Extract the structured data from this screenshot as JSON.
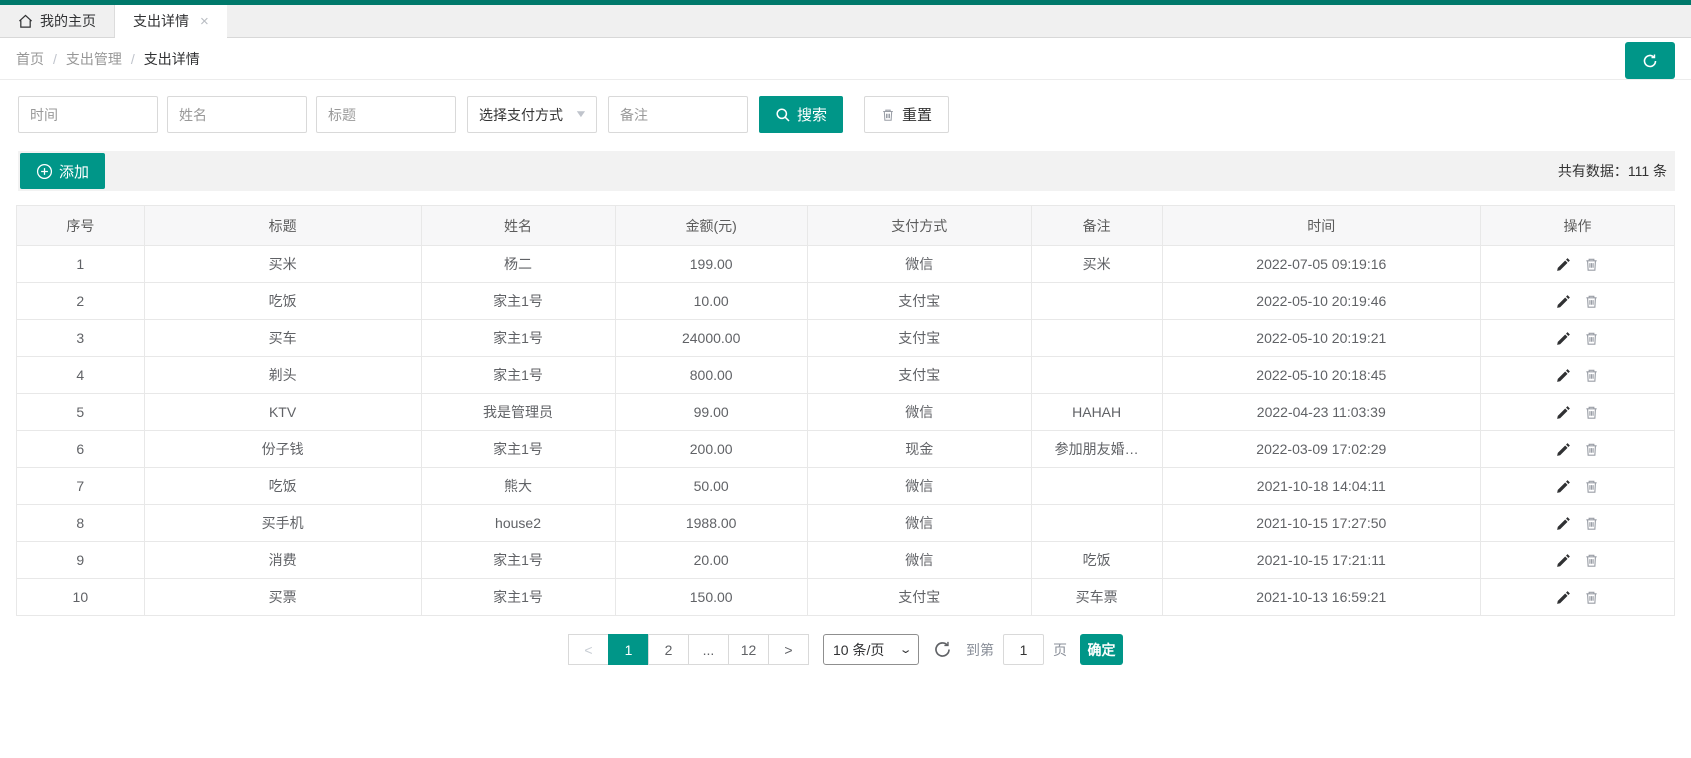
{
  "accent_color": "#009688",
  "top_strip_color": "#00796b",
  "tabs": {
    "home": {
      "label": "我的主页",
      "icon": "home-icon"
    },
    "active": {
      "label": "支出详情",
      "close_icon": "×"
    }
  },
  "breadcrumb": {
    "items": [
      "首页",
      "支出管理",
      "支出详情"
    ],
    "separator": "/"
  },
  "header_actions": {
    "refresh_icon": "refresh"
  },
  "search": {
    "time_placeholder": "时间",
    "name_placeholder": "姓名",
    "title_placeholder": "标题",
    "pay_select_value": "选择支付方式",
    "remark_placeholder": "备注",
    "search_label": "搜索",
    "reset_label": "重置"
  },
  "toolbar": {
    "add_label": "添加",
    "total_label": "共有数据：",
    "total_count": "111",
    "total_unit": "条"
  },
  "table": {
    "headers": [
      "序号",
      "标题",
      "姓名",
      "金额(元)",
      "支付方式",
      "备注",
      "时间",
      "操作"
    ],
    "rows": [
      {
        "no": "1",
        "title": "买米",
        "name": "杨二",
        "amount": "199.00",
        "pay": "微信",
        "remark": "买米",
        "time": "2022-07-05 09:19:16"
      },
      {
        "no": "2",
        "title": "吃饭",
        "name": "家主1号",
        "amount": "10.00",
        "pay": "支付宝",
        "remark": "",
        "time": "2022-05-10 20:19:46"
      },
      {
        "no": "3",
        "title": "买车",
        "name": "家主1号",
        "amount": "24000.00",
        "pay": "支付宝",
        "remark": "",
        "time": "2022-05-10 20:19:21"
      },
      {
        "no": "4",
        "title": "剃头",
        "name": "家主1号",
        "amount": "800.00",
        "pay": "支付宝",
        "remark": "",
        "time": "2022-05-10 20:18:45"
      },
      {
        "no": "5",
        "title": "KTV",
        "name": "我是管理员",
        "amount": "99.00",
        "pay": "微信",
        "remark": "HAHAH",
        "time": "2022-04-23 11:03:39"
      },
      {
        "no": "6",
        "title": "份子钱",
        "name": "家主1号",
        "amount": "200.00",
        "pay": "现金",
        "remark": "参加朋友婚…",
        "time": "2022-03-09 17:02:29"
      },
      {
        "no": "7",
        "title": "吃饭",
        "name": "熊大",
        "amount": "50.00",
        "pay": "微信",
        "remark": "",
        "time": "2021-10-18 14:04:11"
      },
      {
        "no": "8",
        "title": "买手机",
        "name": "house2",
        "amount": "1988.00",
        "pay": "微信",
        "remark": "",
        "time": "2021-10-15 17:27:50"
      },
      {
        "no": "9",
        "title": "消费",
        "name": "家主1号",
        "amount": "20.00",
        "pay": "微信",
        "remark": "吃饭",
        "time": "2021-10-15 17:21:11"
      },
      {
        "no": "10",
        "title": "买票",
        "name": "家主1号",
        "amount": "150.00",
        "pay": "支付宝",
        "remark": "买车票",
        "time": "2021-10-13 16:59:21"
      }
    ]
  },
  "pagination": {
    "prev_label": "<",
    "pages": [
      {
        "label": "1",
        "active": true
      },
      {
        "label": "2",
        "active": false
      },
      {
        "label": "...",
        "active": false
      },
      {
        "label": "12",
        "active": false
      }
    ],
    "next_label": ">",
    "page_size_value": "10 条/页",
    "goto_label": "到第",
    "goto_value": "1",
    "goto_unit": "页",
    "confirm_label": "确定"
  }
}
